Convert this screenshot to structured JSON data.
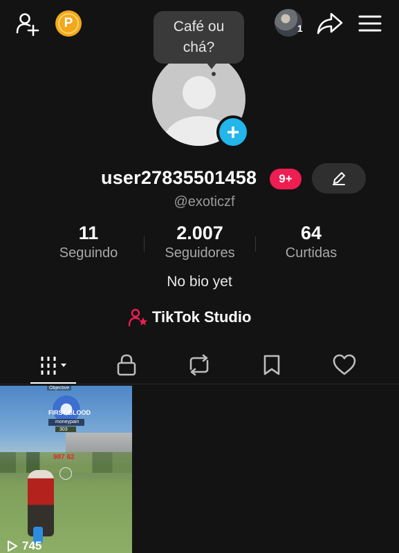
{
  "header": {
    "add_friend_icon": "person-add-icon",
    "coin_letter": "P",
    "friend_count": "1",
    "share_icon": "share-arrow-icon",
    "menu_icon": "hamburger-menu-icon"
  },
  "bubble": {
    "line1": "Café ou",
    "line2": "chá?"
  },
  "profile": {
    "username": "user27835501458",
    "badge": "9+",
    "handle": "@exoticzf",
    "bio": "No bio yet"
  },
  "stats": [
    {
      "value": "11",
      "label": "Seguindo"
    },
    {
      "value": "2.007",
      "label": "Seguidores"
    },
    {
      "value": "64",
      "label": "Curtidas"
    }
  ],
  "studio": {
    "label": "TikTok Studio"
  },
  "tabs": [
    {
      "icon": "grid-icon",
      "active": true
    },
    {
      "icon": "lock-icon",
      "active": false
    },
    {
      "icon": "repost-icon",
      "active": false
    },
    {
      "icon": "bookmark-icon",
      "active": false
    },
    {
      "icon": "heart-icon",
      "active": false
    }
  ],
  "videos": [
    {
      "views": "745",
      "overlay": {
        "objective": "Objective",
        "first_blood": "FIRST BLOOD",
        "player_name": "moneypain",
        "score": "303",
        "damage": "987 62"
      }
    }
  ],
  "colors": {
    "background": "#131313",
    "badge": "#ee1d52",
    "add_avatar": "#22b6ea",
    "coin": "#f2a81d",
    "studio_icon": "#ee1d52"
  }
}
